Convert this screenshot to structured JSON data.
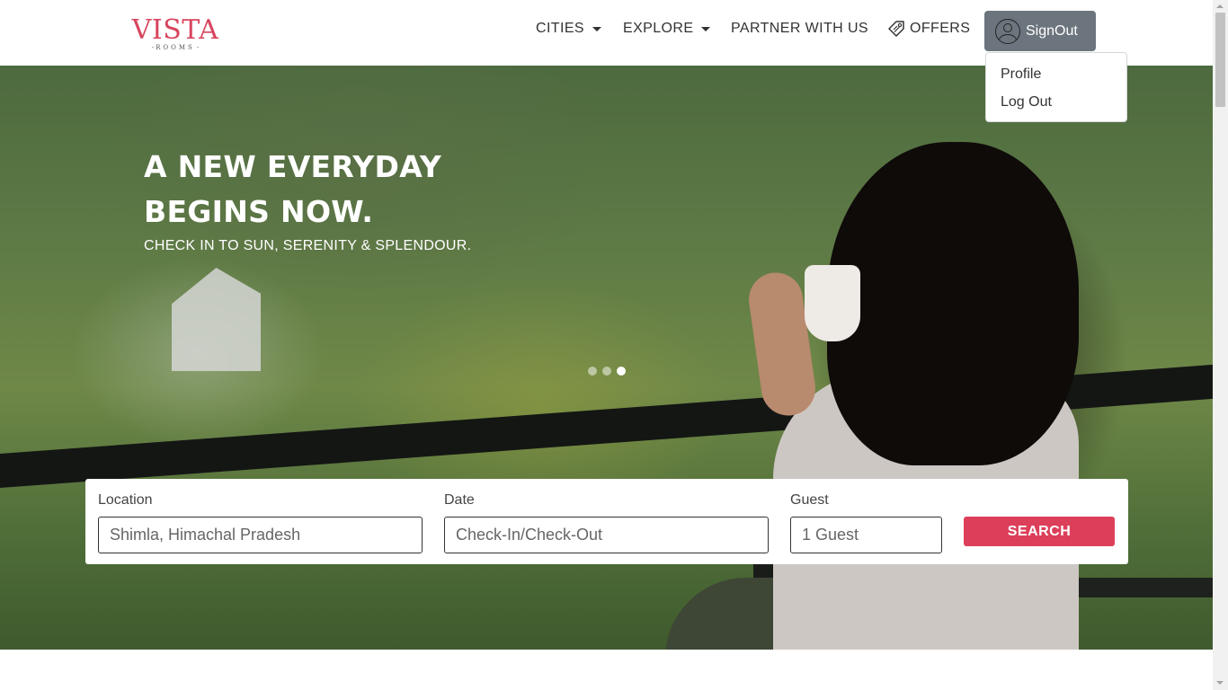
{
  "logo": {
    "main": "VISTA",
    "sub": "ROOMS"
  },
  "nav": {
    "cities": "CITIES",
    "explore": "EXPLORE",
    "partner": "PARTNER WITH US",
    "offers": "OFFERS"
  },
  "account": {
    "button_label": "SignOut",
    "menu": [
      "Profile",
      "Log Out"
    ]
  },
  "hero": {
    "title_line1": "A NEW EVERYDAY",
    "title_line2": "BEGINS NOW.",
    "subtitle": "CHECK IN TO SUN, SERENITY & SPLENDOUR.",
    "carousel_active_index": 3,
    "carousel_count": 3
  },
  "search": {
    "location_label": "Location",
    "location_placeholder": "Shimla, Himachal Pradesh",
    "date_label": "Date",
    "date_placeholder": "Check-In/Check-Out",
    "guest_label": "Guest",
    "guest_value": "1 Guest",
    "button_label": "SEARCH"
  },
  "colors": {
    "brand": "#d8455e",
    "search_button": "#dc3f59",
    "signout_button": "#6c757d"
  },
  "icons": [
    "caret-down-icon",
    "offer-tag-icon",
    "user-icon"
  ]
}
